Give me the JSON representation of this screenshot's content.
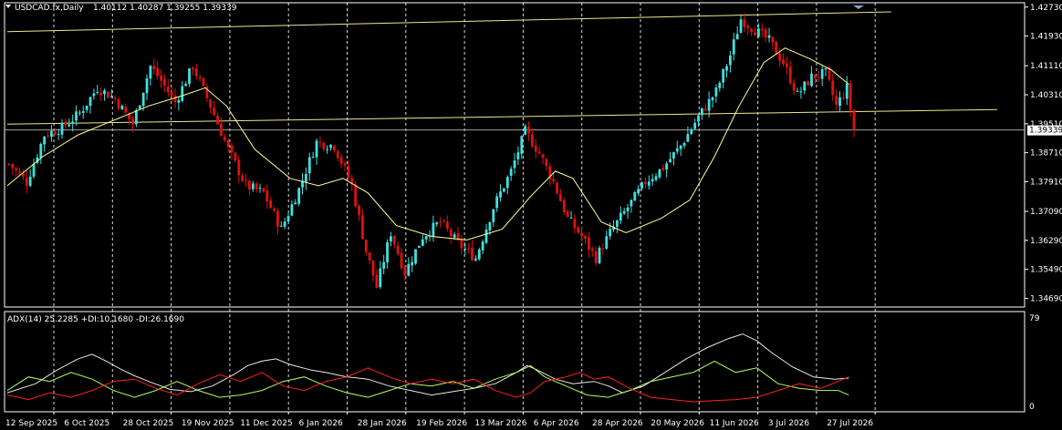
{
  "header": {
    "symbol_timeframe": "USDCAD.fx,Daily",
    "ohlc": "1.40112 1.40287 1.39255 1.39339"
  },
  "colors": {
    "background": "#000000",
    "bull": "#40e0e0",
    "bear": "#e01010",
    "ma": "#ffff99",
    "trendline": "#f0e68c",
    "adx": "#e8e8e8",
    "plus_di": "#b0ff60",
    "minus_di": "#ff2020",
    "grid": "#ffffff",
    "price_marker": "#ffffff"
  },
  "indicator": {
    "label": "ADX(14) 25.2285 +DI:10.1680 -DI:26.1690",
    "axis_labels": [
      "79",
      "0"
    ]
  },
  "chart_data": [
    {
      "type": "candlestick",
      "title": "USDCAD.fx,Daily",
      "y_ticks": [
        "1.42730",
        "1.41930",
        "1.41110",
        "1.40310",
        "1.39510",
        "1.38710",
        "1.37910",
        "1.37090",
        "1.36290",
        "1.35490",
        "1.34690"
      ],
      "ylim": [
        1.3445,
        1.4285
      ],
      "current_price": "1.39339",
      "current_value": 1.39339,
      "x_tick_labels": [
        "12 Sep 2025",
        "6 Oct 2025",
        "28 Oct 2025",
        "19 Nov 2025",
        "11 Dec 2025",
        "6 Jan 2026",
        "28 Jan 2026",
        "19 Feb 2026",
        "13 Mar 2026",
        "6 Apr 2026",
        "28 Apr 2026",
        "20 May 2026",
        "11 Jun 2026",
        "3 Jul 2026",
        "27 Jul 2026"
      ],
      "close_path": [
        [
          0,
          1.384
        ],
        [
          5,
          1.379
        ],
        [
          10,
          1.392
        ],
        [
          15,
          1.394
        ],
        [
          20,
          1.398
        ],
        [
          25,
          1.405
        ],
        [
          30,
          1.402
        ],
        [
          35,
          1.395
        ],
        [
          40,
          1.411
        ],
        [
          43,
          1.407
        ],
        [
          47,
          1.401
        ],
        [
          52,
          1.411
        ],
        [
          57,
          1.4
        ],
        [
          62,
          1.388
        ],
        [
          67,
          1.378
        ],
        [
          72,
          1.376
        ],
        [
          77,
          1.366
        ],
        [
          82,
          1.377
        ],
        [
          87,
          1.39
        ],
        [
          92,
          1.389
        ],
        [
          97,
          1.378
        ],
        [
          101,
          1.36
        ],
        [
          104,
          1.35
        ],
        [
          108,
          1.365
        ],
        [
          112,
          1.354
        ],
        [
          117,
          1.364
        ],
        [
          122,
          1.368
        ],
        [
          127,
          1.362
        ],
        [
          132,
          1.358
        ],
        [
          137,
          1.372
        ],
        [
          142,
          1.382
        ],
        [
          146,
          1.393
        ],
        [
          150,
          1.387
        ],
        [
          154,
          1.379
        ],
        [
          158,
          1.369
        ],
        [
          162,
          1.364
        ],
        [
          166,
          1.358
        ],
        [
          170,
          1.365
        ],
        [
          175,
          1.372
        ],
        [
          180,
          1.379
        ],
        [
          185,
          1.383
        ],
        [
          190,
          1.389
        ],
        [
          195,
          1.397
        ],
        [
          200,
          1.404
        ],
        [
          204,
          1.414
        ],
        [
          207,
          1.424
        ],
        [
          211,
          1.421
        ],
        [
          215,
          1.418
        ],
        [
          219,
          1.412
        ],
        [
          223,
          1.403
        ],
        [
          227,
          1.408
        ],
        [
          231,
          1.409
        ],
        [
          234,
          1.4
        ],
        [
          237,
          1.405
        ],
        [
          239,
          1.3934
        ]
      ],
      "ma_path": [
        [
          0,
          1.378
        ],
        [
          10,
          1.386
        ],
        [
          20,
          1.392
        ],
        [
          30,
          1.396
        ],
        [
          40,
          1.4
        ],
        [
          50,
          1.403
        ],
        [
          56,
          1.405
        ],
        [
          62,
          1.4
        ],
        [
          70,
          1.388
        ],
        [
          80,
          1.38
        ],
        [
          88,
          1.378
        ],
        [
          95,
          1.38
        ],
        [
          102,
          1.376
        ],
        [
          110,
          1.367
        ],
        [
          120,
          1.364
        ],
        [
          130,
          1.363
        ],
        [
          140,
          1.366
        ],
        [
          148,
          1.375
        ],
        [
          155,
          1.382
        ],
        [
          160,
          1.38
        ],
        [
          168,
          1.368
        ],
        [
          175,
          1.365
        ],
        [
          185,
          1.369
        ],
        [
          193,
          1.374
        ],
        [
          200,
          1.386
        ],
        [
          207,
          1.4
        ],
        [
          214,
          1.412
        ],
        [
          220,
          1.416
        ],
        [
          227,
          1.413
        ],
        [
          233,
          1.41
        ],
        [
          238,
          1.406
        ]
      ],
      "trendlines": [
        {
          "from": [
            0,
            1.4205
          ],
          "to": [
            250,
            1.426
          ]
        },
        {
          "from": [
            0,
            1.395
          ],
          "to": [
            280,
            1.399
          ]
        }
      ]
    },
    {
      "type": "line",
      "title": "ADX(14)",
      "ylim": [
        0,
        79
      ],
      "series": [
        {
          "key": "adx",
          "values": [
            [
              0,
              12
            ],
            [
              8,
              20
            ],
            [
              14,
              32
            ],
            [
              20,
              42
            ],
            [
              24,
              46
            ],
            [
              28,
              40
            ],
            [
              32,
              33
            ],
            [
              36,
              27
            ],
            [
              40,
              22
            ],
            [
              46,
              15
            ],
            [
              52,
              13
            ],
            [
              58,
              18
            ],
            [
              64,
              28
            ],
            [
              68,
              36
            ],
            [
              72,
              40
            ],
            [
              76,
              42
            ],
            [
              80,
              37
            ],
            [
              86,
              32
            ],
            [
              90,
              30
            ],
            [
              96,
              26
            ],
            [
              102,
              24
            ],
            [
              108,
              18
            ],
            [
              114,
              14
            ],
            [
              120,
              10
            ],
            [
              126,
              13
            ],
            [
              132,
              16
            ],
            [
              138,
              20
            ],
            [
              144,
              30
            ],
            [
              147,
              36
            ],
            [
              150,
              32
            ],
            [
              155,
              24
            ],
            [
              160,
              20
            ],
            [
              166,
              22
            ],
            [
              170,
              18
            ],
            [
              174,
              12
            ],
            [
              180,
              18
            ],
            [
              186,
              30
            ],
            [
              192,
              42
            ],
            [
              198,
              52
            ],
            [
              204,
              60
            ],
            [
              208,
              64
            ],
            [
              212,
              58
            ],
            [
              216,
              48
            ],
            [
              222,
              35
            ],
            [
              228,
              26
            ],
            [
              234,
              24
            ],
            [
              238,
              25
            ]
          ]
        },
        {
          "key": "plus_di",
          "values": [
            [
              0,
              14
            ],
            [
              6,
              26
            ],
            [
              12,
              22
            ],
            [
              18,
              30
            ],
            [
              24,
              24
            ],
            [
              30,
              14
            ],
            [
              36,
              8
            ],
            [
              42,
              14
            ],
            [
              48,
              22
            ],
            [
              54,
              14
            ],
            [
              60,
              8
            ],
            [
              66,
              10
            ],
            [
              72,
              14
            ],
            [
              78,
              22
            ],
            [
              84,
              26
            ],
            [
              90,
              18
            ],
            [
              96,
              12
            ],
            [
              102,
              8
            ],
            [
              108,
              14
            ],
            [
              114,
              20
            ],
            [
              120,
              18
            ],
            [
              126,
              22
            ],
            [
              132,
              16
            ],
            [
              138,
              24
            ],
            [
              144,
              30
            ],
            [
              148,
              36
            ],
            [
              152,
              26
            ],
            [
              158,
              18
            ],
            [
              164,
              10
            ],
            [
              170,
              8
            ],
            [
              176,
              14
            ],
            [
              182,
              22
            ],
            [
              188,
              26
            ],
            [
              194,
              30
            ],
            [
              200,
              40
            ],
            [
              206,
              30
            ],
            [
              212,
              34
            ],
            [
              218,
              20
            ],
            [
              224,
              16
            ],
            [
              230,
              14
            ],
            [
              235,
              14
            ],
            [
              238,
              10
            ]
          ]
        },
        {
          "key": "minus_di",
          "values": [
            [
              0,
              10
            ],
            [
              6,
              6
            ],
            [
              12,
              12
            ],
            [
              18,
              8
            ],
            [
              24,
              14
            ],
            [
              30,
              22
            ],
            [
              36,
              24
            ],
            [
              42,
              16
            ],
            [
              48,
              10
            ],
            [
              54,
              20
            ],
            [
              60,
              28
            ],
            [
              66,
              22
            ],
            [
              72,
              30
            ],
            [
              78,
              18
            ],
            [
              84,
              14
            ],
            [
              90,
              22
            ],
            [
              96,
              26
            ],
            [
              102,
              34
            ],
            [
              108,
              26
            ],
            [
              114,
              20
            ],
            [
              120,
              24
            ],
            [
              126,
              20
            ],
            [
              132,
              24
            ],
            [
              138,
              14
            ],
            [
              144,
              8
            ],
            [
              148,
              12
            ],
            [
              152,
              22
            ],
            [
              158,
              26
            ],
            [
              162,
              30
            ],
            [
              166,
              24
            ],
            [
              170,
              26
            ],
            [
              176,
              16
            ],
            [
              182,
              8
            ],
            [
              188,
              6
            ],
            [
              194,
              4
            ],
            [
              200,
              5
            ],
            [
              206,
              6
            ],
            [
              212,
              8
            ],
            [
              218,
              14
            ],
            [
              224,
              20
            ],
            [
              230,
              16
            ],
            [
              235,
              22
            ],
            [
              238,
              26
            ]
          ]
        }
      ]
    }
  ]
}
